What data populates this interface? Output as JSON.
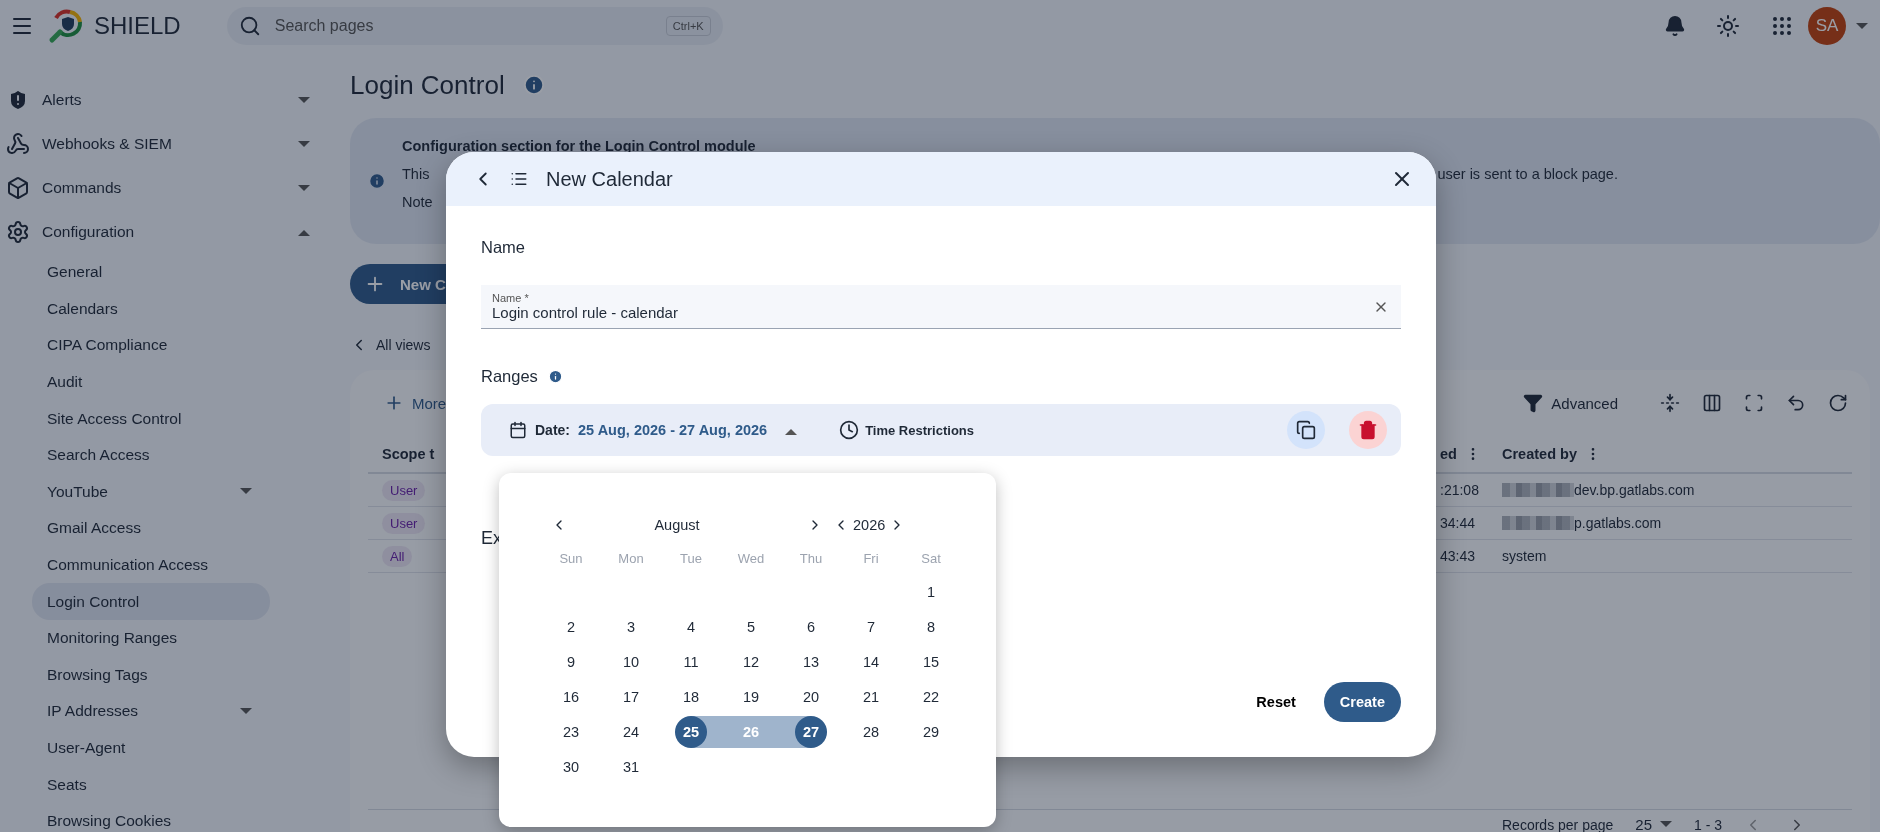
{
  "header": {
    "app_name": "SHIELD",
    "search": {
      "placeholder": "Search pages",
      "shortcut": "Ctrl+K"
    },
    "avatar": "SA"
  },
  "sidebar": {
    "items": [
      {
        "label": "Alerts",
        "expanded": false
      },
      {
        "label": "Webhooks & SIEM",
        "expanded": false
      },
      {
        "label": "Commands",
        "expanded": false
      },
      {
        "label": "Configuration",
        "expanded": true,
        "children": [
          {
            "label": "General",
            "selected": false,
            "kind": "link"
          },
          {
            "label": "Calendars",
            "selected": false,
            "kind": "link"
          },
          {
            "label": "CIPA Compliance",
            "selected": false,
            "kind": "link"
          },
          {
            "label": "Audit",
            "selected": false,
            "kind": "link"
          },
          {
            "label": "Site Access Control",
            "selected": false,
            "kind": "link"
          },
          {
            "label": "Search Access",
            "selected": false,
            "kind": "link"
          },
          {
            "label": "YouTube",
            "selected": false,
            "kind": "group"
          },
          {
            "label": "Gmail Access",
            "selected": false,
            "kind": "link"
          },
          {
            "label": "Communication Access",
            "selected": false,
            "kind": "link"
          },
          {
            "label": "Login Control",
            "selected": true,
            "kind": "link"
          },
          {
            "label": "Monitoring Ranges",
            "selected": false,
            "kind": "link"
          },
          {
            "label": "Browsing Tags",
            "selected": false,
            "kind": "link"
          },
          {
            "label": "IP Addresses",
            "selected": false,
            "kind": "group"
          },
          {
            "label": "User-Agent",
            "selected": false,
            "kind": "link"
          },
          {
            "label": "Seats",
            "selected": false,
            "kind": "link"
          },
          {
            "label": "Browsing Cookies",
            "selected": false,
            "kind": "link"
          }
        ]
      }
    ]
  },
  "page": {
    "title": "Login Control",
    "info": {
      "heading": "Configuration section for the Login Control module",
      "line_start": "This",
      "line_end": "user is sent to a block page.",
      "note": "Note"
    },
    "new_button": "New C",
    "back_link": "All views",
    "table": {
      "more": "More",
      "advanced": "Advanced",
      "columns": [
        "Scope t",
        "ed",
        "Created by"
      ],
      "rows": [
        {
          "scope": "User",
          "time": ":21:08",
          "created_by": "dev.bp.gatlabs.com",
          "redacted": true
        },
        {
          "scope": "User",
          "time": "34:44",
          "created_by": "p.gatlabs.com",
          "redacted": true
        },
        {
          "scope": "All",
          "time": "43:43",
          "created_by": "system",
          "redacted": false
        }
      ],
      "footer": {
        "records_label": "Records per page",
        "per_page": "25",
        "range": "1 - 3"
      }
    }
  },
  "dialog": {
    "title": "New Calendar",
    "name_section": "Name",
    "name_field": {
      "label": "Name *",
      "value": "Login control rule - calendar"
    },
    "ranges_label": "Ranges",
    "range": {
      "date_label": "Date:",
      "date_value": "25 Aug, 2026 - 27 Aug, 2026",
      "time_label": "Time Restrictions",
      "expanded": true
    },
    "exceptions_label": "Ex",
    "buttons": {
      "reset": "Reset",
      "create": "Create"
    },
    "calendar": {
      "month": "August",
      "year": "2026",
      "weekdays": [
        "Sun",
        "Mon",
        "Tue",
        "Wed",
        "Thu",
        "Fri",
        "Sat"
      ],
      "weeks": [
        [
          {
            "label": "1",
            "selected": false,
            "in_range": false
          }
        ],
        [
          {
            "label": "2",
            "selected": false,
            "in_range": false
          },
          {
            "label": "3",
            "selected": false,
            "in_range": false
          },
          {
            "label": "4",
            "selected": false,
            "in_range": false
          },
          {
            "label": "5",
            "selected": false,
            "in_range": false
          },
          {
            "label": "6",
            "selected": false,
            "in_range": false
          },
          {
            "label": "7",
            "selected": false,
            "in_range": false
          },
          {
            "label": "8",
            "selected": false,
            "in_range": false
          }
        ],
        [
          {
            "label": "9",
            "selected": false,
            "in_range": false
          },
          {
            "label": "10",
            "selected": false,
            "in_range": false
          },
          {
            "label": "11",
            "selected": false,
            "in_range": false
          },
          {
            "label": "12",
            "selected": false,
            "in_range": false
          },
          {
            "label": "13",
            "selected": false,
            "in_range": false
          },
          {
            "label": "14",
            "selected": false,
            "in_range": false
          },
          {
            "label": "15",
            "selected": false,
            "in_range": false
          }
        ],
        [
          {
            "label": "16",
            "selected": false,
            "in_range": false
          },
          {
            "label": "17",
            "selected": false,
            "in_range": false
          },
          {
            "label": "18",
            "selected": false,
            "in_range": false
          },
          {
            "label": "19",
            "selected": false,
            "in_range": false
          },
          {
            "label": "20",
            "selected": false,
            "in_range": false
          },
          {
            "label": "21",
            "selected": false,
            "in_range": false
          },
          {
            "label": "22",
            "selected": false,
            "in_range": false
          }
        ],
        [
          {
            "label": "23",
            "selected": false,
            "in_range": false
          },
          {
            "label": "24",
            "selected": false,
            "in_range": false
          },
          {
            "label": "25",
            "selected": true,
            "in_range": true
          },
          {
            "label": "26",
            "selected": false,
            "in_range": true
          },
          {
            "label": "27",
            "selected": true,
            "in_range": true
          },
          {
            "label": "28",
            "selected": false,
            "in_range": false
          },
          {
            "label": "29",
            "selected": false,
            "in_range": false
          }
        ],
        [
          {
            "label": "30",
            "selected": false,
            "in_range": false
          },
          {
            "label": "31",
            "selected": false,
            "in_range": false
          }
        ]
      ]
    }
  }
}
